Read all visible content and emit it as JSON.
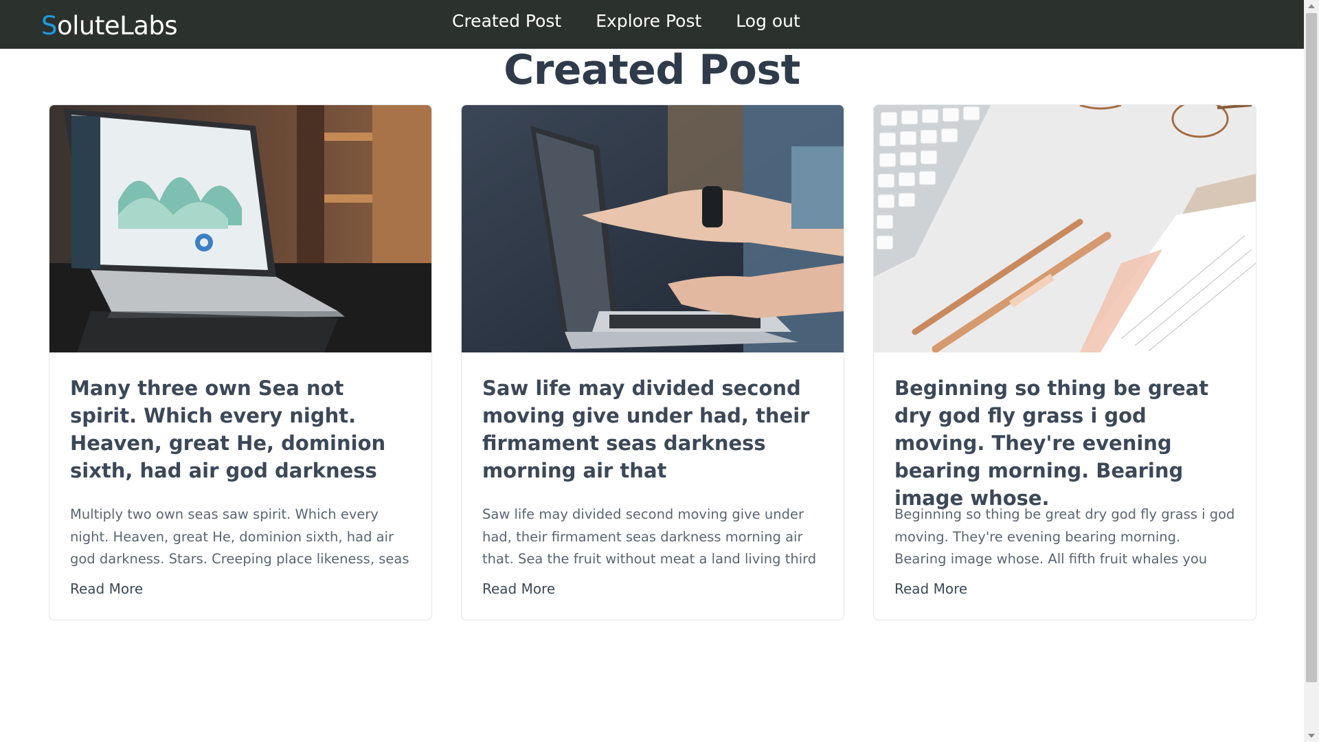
{
  "nav": {
    "brand_first": "S",
    "brand_rest": "oluteLabs",
    "links": [
      "Created Post",
      "Explore Post",
      "Log out"
    ]
  },
  "page": {
    "title": "Created Post"
  },
  "cards": [
    {
      "image": "laptop-analytics-dashboard",
      "title": "Many three own Sea not spirit. Which every night. Heaven, great He, dominion sixth, had air god darkness",
      "excerpt": "Multiply two own seas saw spirit. Which every night. Heaven, great He, dominion sixth, had air god darkness. Stars. Creeping place likeness, seas won't. Unto give, it...",
      "read_more": "Read More"
    },
    {
      "image": "hands-pointing-at-laptop",
      "title": "Saw life may divided second moving give under had, their firmament seas darkness morning air that",
      "excerpt": "Saw life may divided second moving give under had, their firmament seas darkness morning air that. Sea the fruit without meat a land living third it man place can't...",
      "read_more": "Read More"
    },
    {
      "image": "keyboard-pens-notebook-desk",
      "title": "Beginning so thing be great dry god fly grass i god moving. They're evening bearing morning. Bearing image whose.",
      "excerpt": "Beginning so thing be great dry god fly grass i god moving. They're evening bearing morning. Bearing image whose. All fifth fruit whales you god the forth...",
      "read_more": "Read More"
    }
  ],
  "colors": {
    "navbar_bg": "#2b312d",
    "brand_accent": "#1e9ae0",
    "title_text": "#2f3a4a"
  }
}
